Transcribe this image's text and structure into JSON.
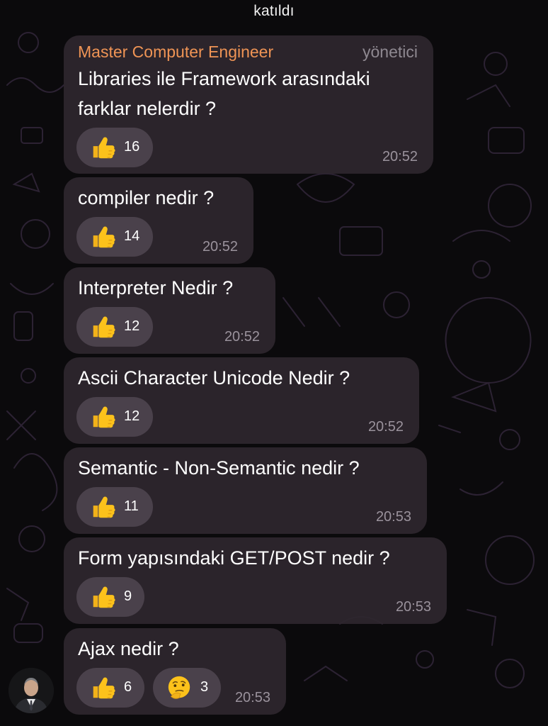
{
  "service_message": "katıldı",
  "group_header": {
    "sender": "Master Computer Engineer",
    "role": "yönetici"
  },
  "messages": [
    {
      "lines": [
        "Libraries ile Framework arasındaki",
        "farklar nelerdir ?"
      ],
      "reactions": [
        {
          "emoji": "thumbs-up",
          "count": "16"
        }
      ],
      "time": "20:52"
    },
    {
      "lines": [
        "compiler nedir ?"
      ],
      "reactions": [
        {
          "emoji": "thumbs-up",
          "count": "14"
        }
      ],
      "time": "20:52"
    },
    {
      "lines": [
        "Interpreter Nedir ?"
      ],
      "reactions": [
        {
          "emoji": "thumbs-up",
          "count": "12"
        }
      ],
      "time": "20:52"
    },
    {
      "lines": [
        "Ascii Character  Unicode Nedir ?"
      ],
      "reactions": [
        {
          "emoji": "thumbs-up",
          "count": "12"
        }
      ],
      "time": "20:52"
    },
    {
      "lines": [
        "Semantic - Non-Semantic nedir ?"
      ],
      "reactions": [
        {
          "emoji": "thumbs-up",
          "count": "11"
        }
      ],
      "time": "20:53"
    },
    {
      "lines": [
        "Form yapısındaki GET/POST nedir ?"
      ],
      "reactions": [
        {
          "emoji": "thumbs-up",
          "count": "9"
        }
      ],
      "time": "20:53"
    },
    {
      "lines": [
        "Ajax nedir ?"
      ],
      "reactions": [
        {
          "emoji": "thumbs-up",
          "count": "6"
        },
        {
          "emoji": "thinking-face",
          "count": "3"
        }
      ],
      "time": "20:53"
    }
  ],
  "colors": {
    "background": "#0b0a0c",
    "bubble": "#2e262e",
    "sender_name": "#ef9455",
    "role_label": "#8e8890",
    "timestamp": "#9a929c",
    "reaction_pill": "#584f5a"
  },
  "sender_avatar_icon": "avatar-photo"
}
